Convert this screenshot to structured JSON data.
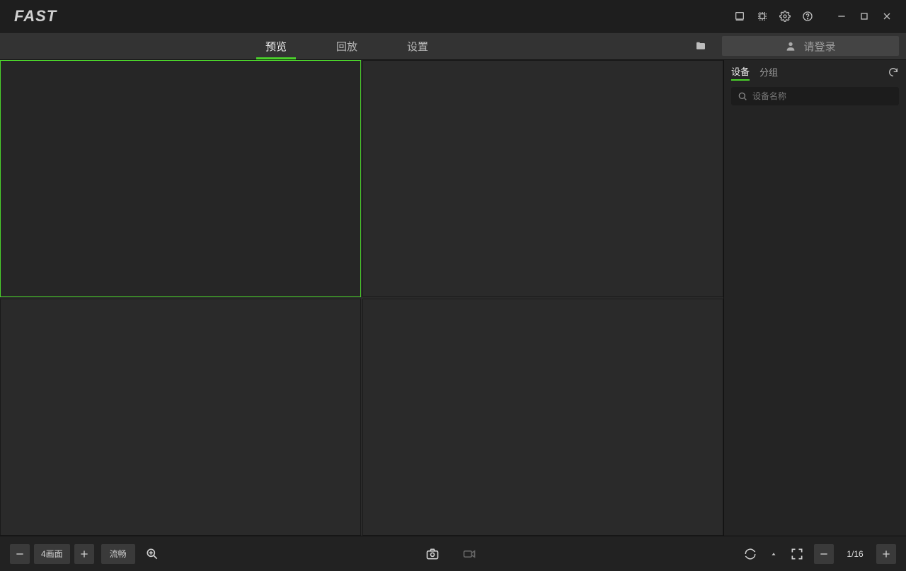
{
  "app": {
    "name": "FAST"
  },
  "tabs": {
    "preview": "预览",
    "playback": "回放",
    "settings": "设置",
    "active": "preview"
  },
  "toolbar": {
    "login_label": "请登录"
  },
  "device_panel": {
    "tab_devices": "设备",
    "tab_groups": "分组",
    "active": "devices",
    "search_placeholder": "设备名称"
  },
  "footer": {
    "layout_label": "4画面",
    "quality_label": "流畅",
    "page_indicator": "1/16"
  }
}
